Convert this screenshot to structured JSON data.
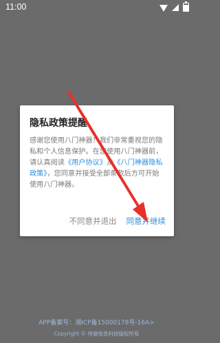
{
  "status_bar": {
    "time": "11:00"
  },
  "dialog": {
    "title": "隐私政策提醒",
    "body_before": "感谢您使用八门神器！我们非常重视您的隐私和个人信息保护。在您使用八门神器前，请认真阅读",
    "user_agreement": "《用户协议》",
    "and": "及",
    "privacy_policy": "《八门神器隐私政策》",
    "body_after": "，您同意并接受全部条款后方可开始使用八门神器。",
    "disagree": "不同意并退出",
    "agree": "同意并继续"
  },
  "footer": {
    "icp": "APP备案号：湘ICP备15000178号-16A>",
    "copyright": "Copyright © 悖骏信息科技版权所有"
  },
  "colors": {
    "link": "#2e8fe0",
    "overlay": "#6b6b6b",
    "arrow": "#e8302a"
  }
}
